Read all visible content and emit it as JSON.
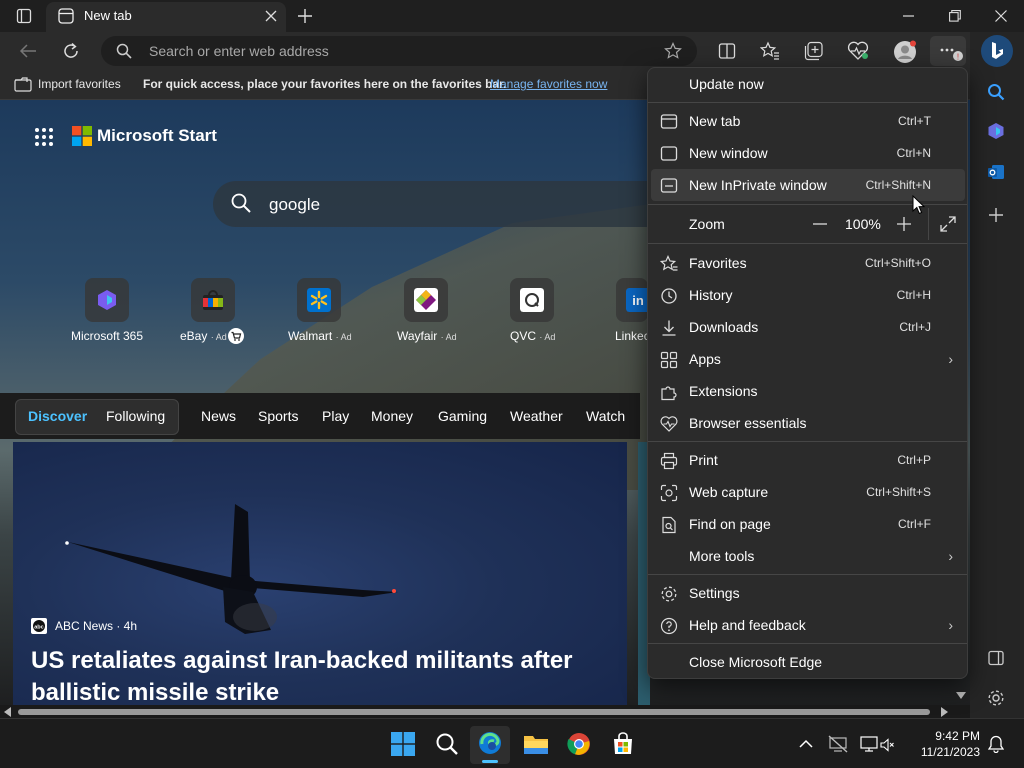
{
  "browser": {
    "tab_title": "New tab",
    "address_placeholder": "Search or enter web address"
  },
  "favorites_bar": {
    "import_label": "Import favorites",
    "hint_text": "For quick access, place your favorites here on the favorites bar.",
    "manage_link": "Manage favorites now"
  },
  "page": {
    "brand": "Microsoft Start",
    "search_query": "google",
    "tiles": [
      {
        "label": "Microsoft 365",
        "ad": ""
      },
      {
        "label": "eBay",
        "ad": "· Ad"
      },
      {
        "label": "Walmart",
        "ad": "· Ad"
      },
      {
        "label": "Wayfair",
        "ad": "· Ad"
      },
      {
        "label": "QVC",
        "ad": "· Ad"
      },
      {
        "label": "Linkec",
        "ad": ""
      }
    ],
    "nav": {
      "discover": "Discover",
      "following": "Following",
      "items": [
        "News",
        "Sports",
        "Play",
        "Money",
        "Gaming",
        "Weather",
        "Watch"
      ]
    },
    "article": {
      "source": "ABC News · 4h",
      "headline": "US retaliates against Iran-backed militants after ballistic missile strike"
    }
  },
  "menu": {
    "update_now": "Update now",
    "items": {
      "new_tab": {
        "label": "New tab",
        "shortcut": "Ctrl+T"
      },
      "new_window": {
        "label": "New window",
        "shortcut": "Ctrl+N"
      },
      "new_private": {
        "label": "New InPrivate window",
        "shortcut": "Ctrl+Shift+N"
      },
      "zoom": {
        "label": "Zoom",
        "minus": "—",
        "value": "100%",
        "plus": "+"
      },
      "favorites": {
        "label": "Favorites",
        "shortcut": "Ctrl+Shift+O"
      },
      "history": {
        "label": "History",
        "shortcut": "Ctrl+H"
      },
      "downloads": {
        "label": "Downloads",
        "shortcut": "Ctrl+J"
      },
      "apps": {
        "label": "Apps"
      },
      "extensions": {
        "label": "Extensions"
      },
      "essentials": {
        "label": "Browser essentials"
      },
      "print": {
        "label": "Print",
        "shortcut": "Ctrl+P"
      },
      "web_capture": {
        "label": "Web capture",
        "shortcut": "Ctrl+Shift+S"
      },
      "find": {
        "label": "Find on page",
        "shortcut": "Ctrl+F"
      },
      "more_tools": {
        "label": "More tools"
      },
      "settings": {
        "label": "Settings"
      },
      "help": {
        "label": "Help and feedback"
      },
      "close_edge": {
        "label": "Close Microsoft Edge"
      }
    }
  },
  "taskbar": {
    "time": "9:42 PM",
    "date": "11/21/2023"
  },
  "colors": {
    "accent": "#4cc2ff",
    "menu_bg": "#2b2b2b",
    "link": "#78b4f0"
  },
  "icons": [
    "tab-actions-icon",
    "edge-tab-icon",
    "close-icon",
    "plus-icon",
    "minimize-icon",
    "restore-icon",
    "back-icon",
    "refresh-icon",
    "search-icon",
    "star-icon",
    "split-screen-icon",
    "favorites-icon",
    "collections-icon",
    "browser-essentials-icon",
    "profile-icon",
    "more-icon",
    "copilot-icon",
    "bell-icon"
  ]
}
